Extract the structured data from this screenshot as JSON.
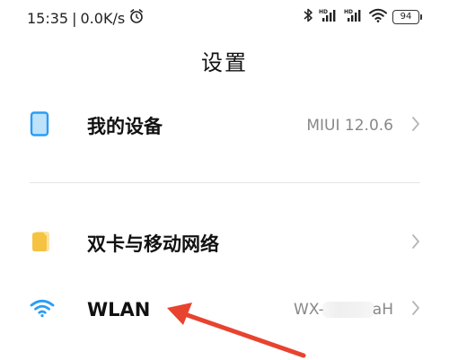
{
  "status_bar": {
    "time": "15:35",
    "separator": "|",
    "net_speed": "0.0K/s",
    "battery_level": "94",
    "icons": [
      "alarm-icon",
      "bluetooth-icon",
      "hd-signal-icon",
      "hd-signal-icon",
      "wifi-icon",
      "battery-icon"
    ]
  },
  "header": {
    "title": "设置"
  },
  "rows": [
    {
      "label": "我的设备",
      "value": "MIUI 12.0.6",
      "icon": "phone-icon"
    },
    {
      "label": "双卡与移动网络",
      "value": "",
      "icon": "sim-card-icon"
    },
    {
      "label": "WLAN",
      "value_prefix": "WX-",
      "value_suffix": "aH",
      "icon": "wifi-icon"
    }
  ],
  "colors": {
    "accent_blue": "#2a9df4",
    "sim_yellow": "#f5c242",
    "annotation_arrow": "#e8432f",
    "chevron": "#b5b5b5"
  }
}
